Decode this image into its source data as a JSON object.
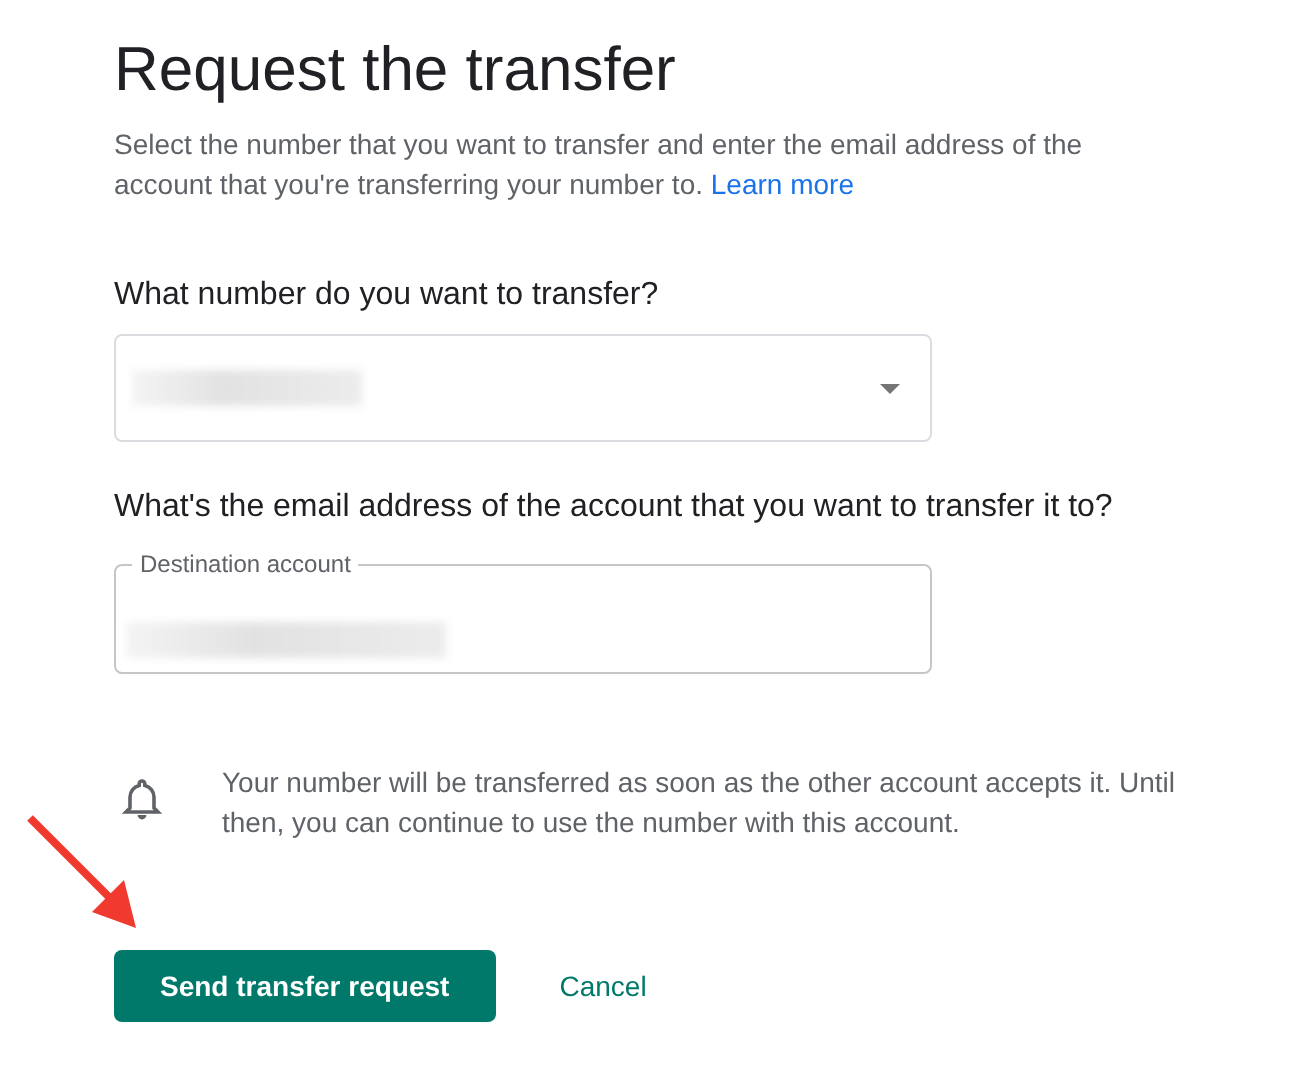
{
  "title": "Request the transfer",
  "description": {
    "text": "Select the number that you want to transfer and enter the email address of the account that you're transferring your number to.",
    "link": "Learn more"
  },
  "number_question": "What number do you want to transfer?",
  "number_select": {
    "redacted": true
  },
  "email_question": "What's the email address of the account that you want to transfer it to?",
  "destination_field": {
    "label": "Destination account",
    "redacted": true
  },
  "notice": "Your number will be transferred as soon as the other account accepts it. Until then, you can continue to use the number with this account.",
  "buttons": [
    {
      "label": "Send transfer request",
      "kind": "primary"
    },
    {
      "label": "Cancel",
      "kind": "text"
    }
  ],
  "annotation": {
    "kind": "arrow"
  }
}
